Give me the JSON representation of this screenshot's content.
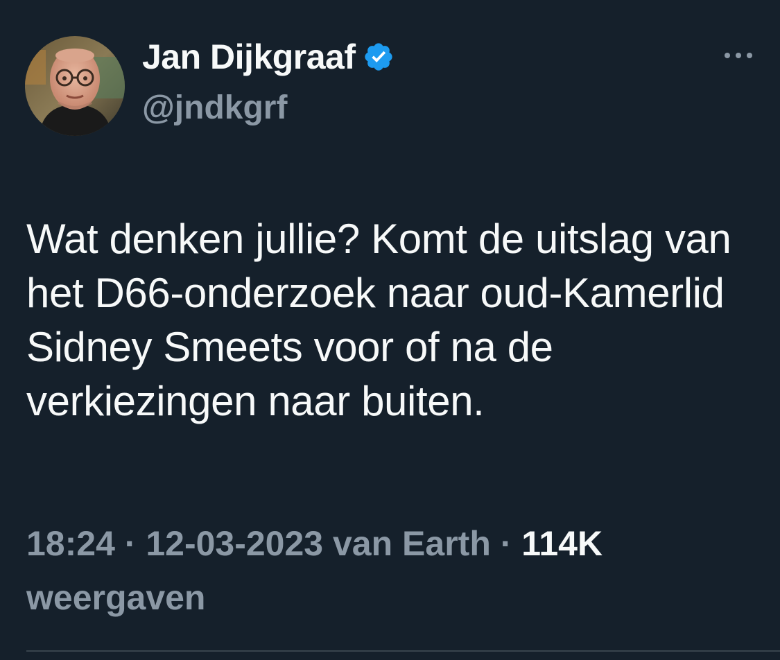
{
  "author": {
    "display_name": "Jan Dijkgraaf",
    "handle": "@jndkgrf",
    "verified_icon": "verified-badge-icon"
  },
  "more_icon": "more-horizontal-icon",
  "tweet": {
    "text": "Wat denken jullie? Komt de uitslag van het D66-onderzoek naar oud-Kamerlid Sidney Smeets voor of na de verkiezingen naar buiten."
  },
  "meta": {
    "time": "18:24",
    "separator": " · ",
    "date": "12-03-2023",
    "source": "van Earth",
    "views_count": "114K",
    "views_label": "weergaven"
  },
  "colors": {
    "background": "#15202b",
    "text_primary": "#f7f9f9",
    "text_secondary": "#8b98a5",
    "verified": "#1d9bf0",
    "divider": "#38444d"
  }
}
